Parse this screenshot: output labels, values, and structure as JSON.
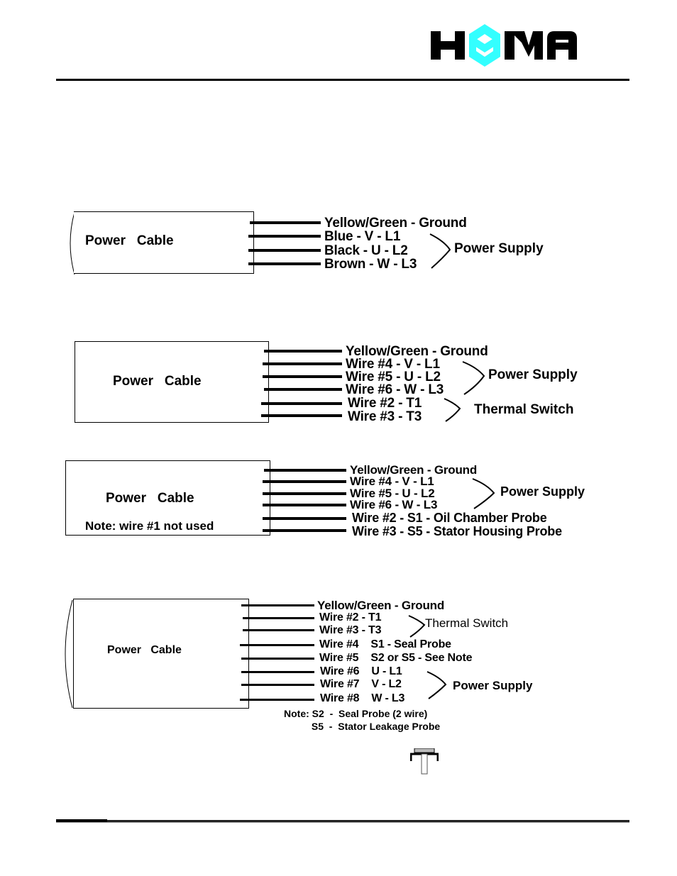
{
  "header": {
    "logo_text": "HOMA",
    "logo_accent_color": "#33ffff"
  },
  "diagrams": [
    {
      "box_label": "Power   Cable",
      "wires": [
        "Yellow/Green - Ground",
        "Blue - V - L1",
        "Black - U - L2",
        "Brown - W - L3"
      ],
      "groups": [
        {
          "label": "Power Supply",
          "wires": [
            1,
            2,
            3
          ]
        }
      ]
    },
    {
      "box_label": "Power   Cable",
      "wires": [
        "Yellow/Green  - Ground",
        "Wire #4 - V - L1",
        "Wire #5 - U - L2",
        "Wire #6 - W - L3",
        "Wire #2 - T1",
        "Wire #3 - T3"
      ],
      "groups": [
        {
          "label": "Power Supply",
          "wires": [
            1,
            2,
            3
          ]
        },
        {
          "label": "Thermal Switch",
          "wires": [
            4,
            5
          ]
        }
      ]
    },
    {
      "box_label": "Power   Cable",
      "box_note": "Note: wire #1 not used",
      "wires": [
        "Yellow/Green  - Ground",
        "Wire #4 - V - L1",
        "Wire #5 - U - L2",
        "Wire #6 - W - L3",
        "Wire #2 - S1 - Oil Chamber Probe",
        "Wire #3 - S5 - Stator Housing Probe"
      ],
      "groups": [
        {
          "label": "Power Supply",
          "wires": [
            1,
            2,
            3
          ]
        }
      ]
    },
    {
      "box_label": "Power   Cable",
      "wires": [
        "Yellow/Green - Ground",
        "Wire #2 - T1",
        "Wire #3 - T3",
        "Wire #4    S1 - Seal Probe",
        "Wire #5    S2 or S5 - See Note",
        "Wire #6    U - L1",
        "Wire #7    V - L2",
        "Wire #8    W - L3"
      ],
      "groups": [
        {
          "label": "Thermal Switch",
          "wires": [
            1,
            2
          ]
        },
        {
          "label": "Power Supply",
          "wires": [
            5,
            6,
            7
          ]
        }
      ],
      "note_lines": [
        "Note: S2  -  Seal Probe (2 wire)",
        "          S5  -  Stator Leakage Probe"
      ]
    }
  ]
}
